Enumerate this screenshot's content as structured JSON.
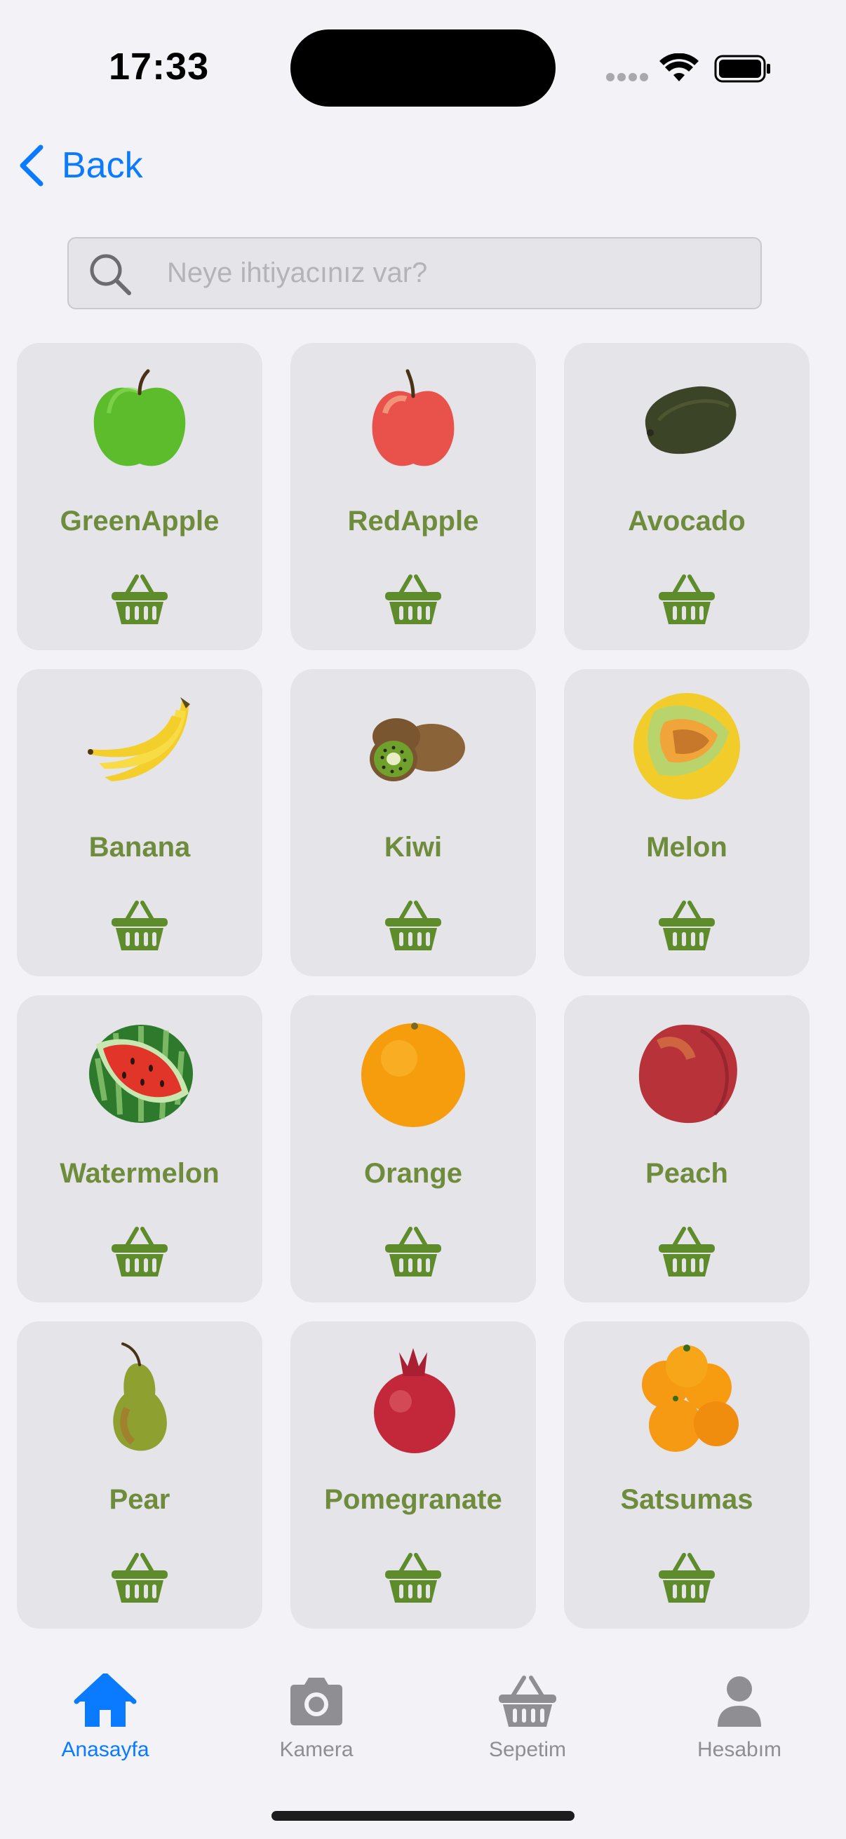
{
  "status_bar": {
    "time": "17:33",
    "signal_icon": "cellular-dots-icon",
    "wifi_icon": "wifi-icon",
    "battery_icon": "battery-full-icon"
  },
  "nav": {
    "back_label": "Back",
    "back_icon": "chevron-left-icon"
  },
  "search": {
    "placeholder": "Neye ihtiyacınız var?",
    "value": "",
    "icon": "magnifier-icon"
  },
  "products": [
    {
      "name": "GreenApple",
      "image": "green-apple"
    },
    {
      "name": "RedApple",
      "image": "red-apple"
    },
    {
      "name": "Avocado",
      "image": "avocado"
    },
    {
      "name": "Banana",
      "image": "banana"
    },
    {
      "name": "Kiwi",
      "image": "kiwi"
    },
    {
      "name": "Melon",
      "image": "melon"
    },
    {
      "name": "Watermelon",
      "image": "watermelon"
    },
    {
      "name": "Orange",
      "image": "orange"
    },
    {
      "name": "Peach",
      "image": "peach"
    },
    {
      "name": "Pear",
      "image": "pear"
    },
    {
      "name": "Pomegranate",
      "image": "pomegranate"
    },
    {
      "name": "Satsumas",
      "image": "satsumas"
    }
  ],
  "tab_bar": {
    "tabs": [
      {
        "label": "Anasayfa",
        "icon": "house-icon",
        "active": true
      },
      {
        "label": "Kamera",
        "icon": "camera-icon",
        "active": false
      },
      {
        "label": "Sepetim",
        "icon": "basket-icon",
        "active": false
      },
      {
        "label": "Hesabım",
        "icon": "person-icon",
        "active": false
      }
    ]
  },
  "colors": {
    "accent": "#0a7aff",
    "product_green": "#6e8c3c",
    "basket_green": "#5f8c2a",
    "card_bg": "#e4e4e9",
    "tab_inactive": "#8e8e93"
  }
}
